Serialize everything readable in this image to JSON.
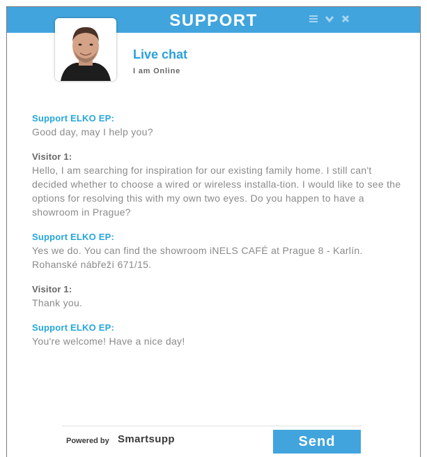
{
  "header": {
    "title": "SUPPORT",
    "icons": [
      "menu-icon",
      "chevron-down-icon",
      "close-icon"
    ]
  },
  "agent": {
    "name": "Live chat",
    "status": "I am Online"
  },
  "messages": [
    {
      "sender": "Support ELKO EP:",
      "role": "support",
      "text": "Good day, may I help you?"
    },
    {
      "sender": "Visitor 1:",
      "role": "visitor",
      "text": "Hello, I am searching for inspiration for our existing family home. I still can't decided whether to choose a wired or wireless installa-tion. I would like to see the options for resolving this with my own two eyes. Do you happen to have a showroom in Prague?"
    },
    {
      "sender": "Support ELKO EP:",
      "role": "support",
      "text": "Yes we do. You can find the showroom iNELS CAFÉ at Prague 8 - Karlín. Rohanské nábřeží 671/15."
    },
    {
      "sender": "Visitor 1:",
      "role": "visitor",
      "text": "Thank you."
    },
    {
      "sender": "Support ELKO EP:",
      "role": "support",
      "text": "You're welcome! Have a nice day!"
    }
  ],
  "footer": {
    "powered_by": "Powered by",
    "brand": "Smartsupp",
    "send_label": "Send"
  },
  "colors": {
    "accent": "#41a4dd",
    "support_name": "#25a6dc",
    "visitor_name": "#666666",
    "message_text": "#8a8a8a"
  }
}
